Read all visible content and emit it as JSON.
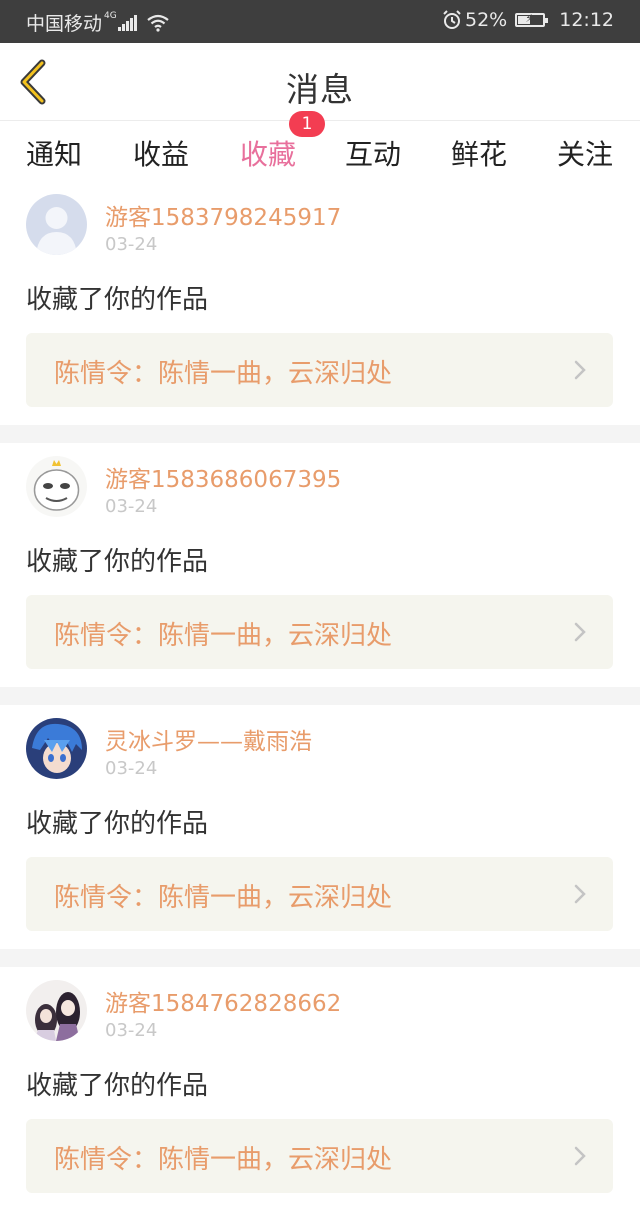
{
  "status_bar": {
    "carrier": "中国移动",
    "network": "4G",
    "battery_percent": "52%",
    "battery_level": 0.52,
    "time": "12:12"
  },
  "header": {
    "back_icon": "chevron-left-icon",
    "title": "消息"
  },
  "tabs": {
    "items": [
      {
        "label": "通知"
      },
      {
        "label": "收益"
      },
      {
        "label": "收藏"
      },
      {
        "label": "互动"
      },
      {
        "label": "鲜花"
      },
      {
        "label": "关注"
      }
    ],
    "active_index": 2,
    "badge": "1"
  },
  "colors": {
    "accent": "#e8709c",
    "username": "#e89c6b",
    "badge": "#f33d52"
  },
  "feed": {
    "items": [
      {
        "user": "游客1583798245917",
        "date": "03-24",
        "action": "收藏了你的作品",
        "work": "陈情令：陈情一曲，云深归处",
        "avatar": "default-avatar-icon"
      },
      {
        "user": "游客1583686067395",
        "date": "03-24",
        "action": "收藏了你的作品",
        "work": "陈情令：陈情一曲，云深归处",
        "avatar": "meme-face-avatar"
      },
      {
        "user": "灵冰斗罗——戴雨浩",
        "date": "03-24",
        "action": "收藏了你的作品",
        "work": "陈情令：陈情一曲，云深归处",
        "avatar": "anime-boy-avatar"
      },
      {
        "user": "游客1584762828662",
        "date": "03-24",
        "action": "收藏了你的作品",
        "work": "陈情令：陈情一曲，云深归处",
        "avatar": "anime-girls-avatar"
      }
    ]
  }
}
